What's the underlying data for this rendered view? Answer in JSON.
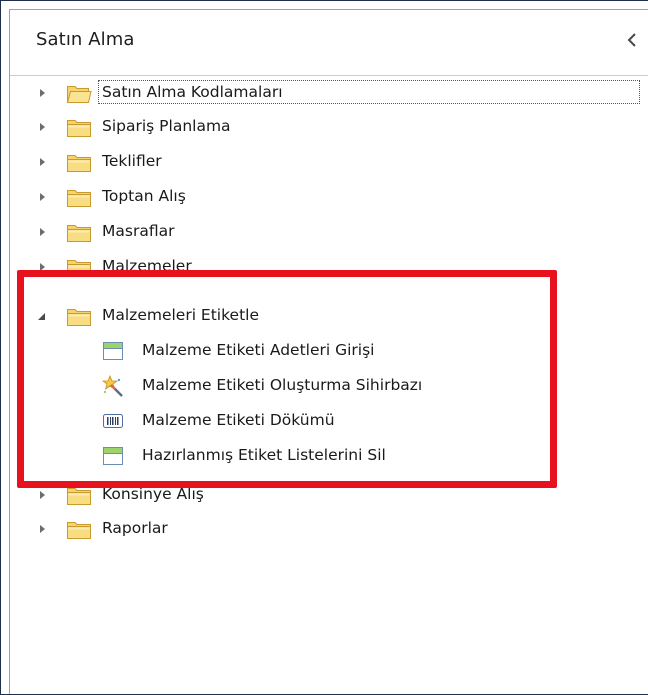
{
  "panel": {
    "title": "Satın Alma",
    "collapse_icon": "chevron-left-icon"
  },
  "tree": {
    "nodes": [
      {
        "label": "Satın Alma Kodlamaları",
        "state": "collapsed",
        "selected": true,
        "icon": "folder-open-icon"
      },
      {
        "label": "Sipariş Planlama",
        "state": "collapsed",
        "icon": "folder-icon"
      },
      {
        "label": "Teklifler",
        "state": "collapsed",
        "icon": "folder-icon"
      },
      {
        "label": "Toptan Alış",
        "state": "collapsed",
        "icon": "folder-icon"
      },
      {
        "label": "Masraflar",
        "state": "collapsed",
        "icon": "folder-icon"
      },
      {
        "label": "Malzemeler",
        "state": "collapsed",
        "icon": "folder-icon",
        "partially_hidden": true
      },
      {
        "label": "Malzemeleri Etiketle",
        "state": "expanded",
        "icon": "folder-icon",
        "children": [
          {
            "label": "Malzeme Etiketi Adetleri Girişi",
            "icon": "form-window-icon"
          },
          {
            "label": "Malzeme Etiketi Oluşturma Sihirbazı",
            "icon": "wizard-icon"
          },
          {
            "label": "Malzeme Etiketi Dökümü",
            "icon": "barcode-icon"
          },
          {
            "label": "Hazırlanmış Etiket Listelerini Sil",
            "icon": "form-window-icon"
          }
        ]
      },
      {
        "label": "Konsinye Alış",
        "state": "collapsed",
        "icon": "folder-icon",
        "partially_hidden": true
      },
      {
        "label": "Raporlar",
        "state": "collapsed",
        "icon": "folder-icon"
      }
    ]
  },
  "colors": {
    "highlight": "#e8121e",
    "folder": "#f2c94c",
    "border": "#1f2f4a"
  }
}
